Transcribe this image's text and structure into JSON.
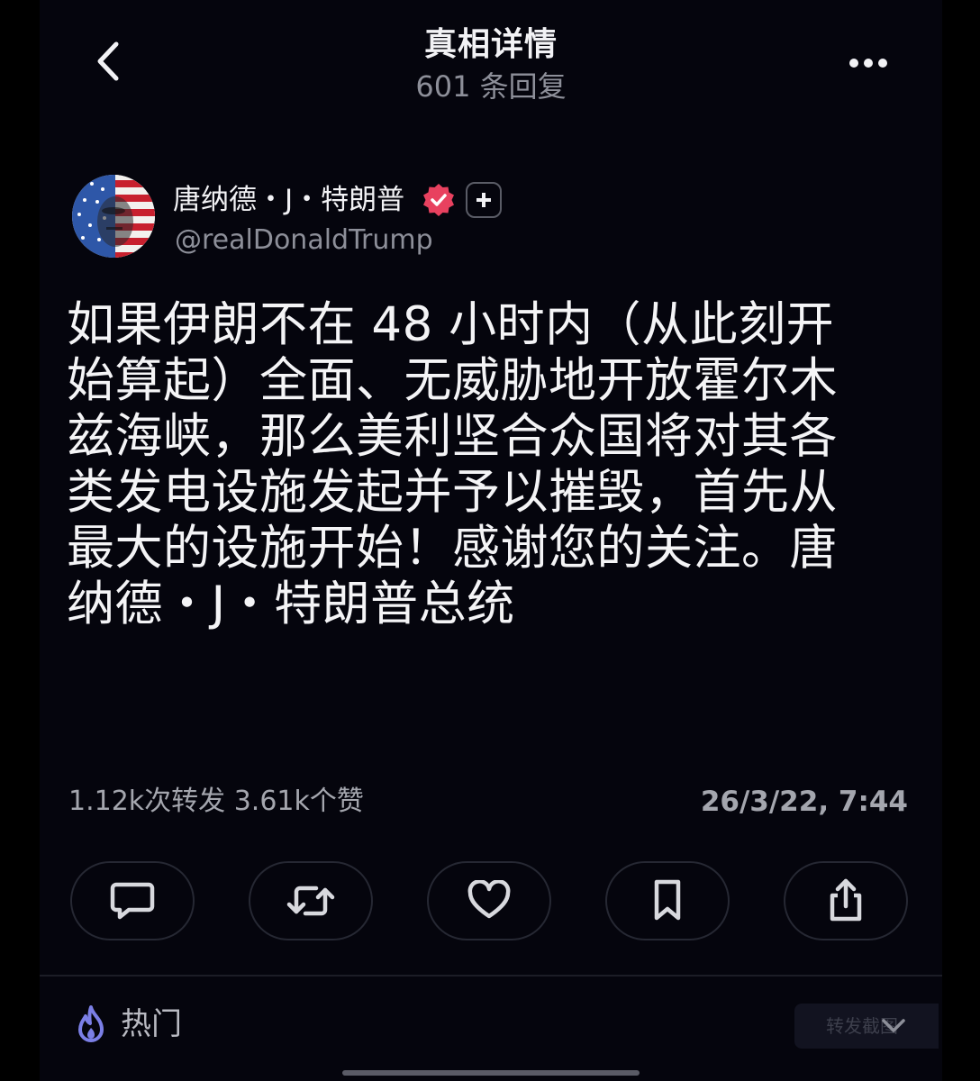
{
  "header": {
    "title": "真相详情",
    "subtitle": "601 条回复"
  },
  "author": {
    "name": "唐纳德・J・特朗普",
    "handle": "@realDonaldTrump"
  },
  "post": {
    "text": "如果伊朗不在 48 小时内（从此刻开始算起）全面、无威胁地开放霍尔木兹海峡，那么美利坚合众国将对其各类发电设施发起并予以摧毁，首先从最大的设施开始！感谢您的关注。唐纳德・J・特朗普总统"
  },
  "stats": {
    "summary": "1.12k次转发 3.61k个赞",
    "timestamp": "26/3/22, 7:44"
  },
  "actions": [
    {
      "name": "reply",
      "icon": "comment-icon"
    },
    {
      "name": "repost",
      "icon": "repost-icon"
    },
    {
      "name": "like",
      "icon": "heart-icon"
    },
    {
      "name": "bookmark",
      "icon": "bookmark-icon"
    },
    {
      "name": "share",
      "icon": "share-icon"
    }
  ],
  "hot": {
    "label": "热门",
    "icon": "flame-icon"
  },
  "share_screenshot": {
    "label": "转发截图"
  },
  "colors": {
    "background": "#05050d",
    "text": "#f4f4f6",
    "muted": "#8d8f99",
    "verified": "#e8415f",
    "hot_icon": "#7b7fe6"
  }
}
